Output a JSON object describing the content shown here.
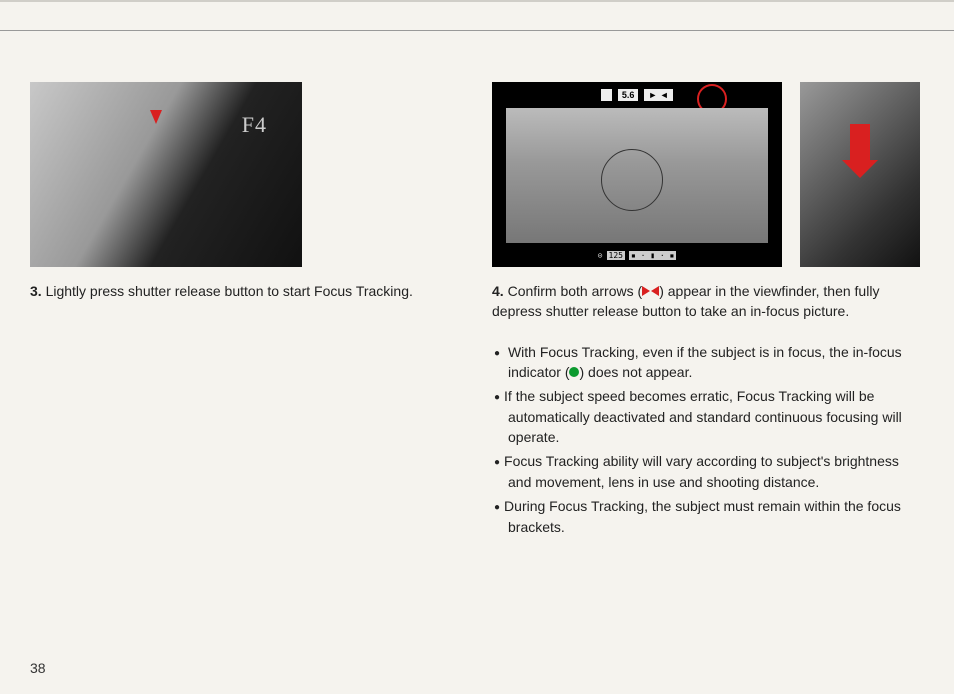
{
  "page_number": "38",
  "viewfinder": {
    "aperture": "5.6",
    "shutter": "125",
    "scale": "▪ · ▮ · ▪"
  },
  "step3": {
    "number": "3.",
    "text": " Lightly press shutter release button to start Focus Tracking."
  },
  "step4": {
    "number": "4.",
    "text_before": " Confirm both arrows ",
    "text_after": " appear in the viewfinder, then fully depress shutter release button to take an in-focus picture."
  },
  "bullets": [
    {
      "before": "With Focus Tracking, even if the subject is in focus, the in-focus indicator ",
      "after": " does not appear."
    },
    {
      "text": "If the subject speed becomes erratic, Focus Tracking will be automatically deactivated and standard continuous focusing will operate."
    },
    {
      "text": "Focus Tracking ability will vary according to subject's brightness and movement, lens in use and shooting distance."
    },
    {
      "text": "During Focus Tracking, the subject must remain within the focus brackets."
    }
  ]
}
